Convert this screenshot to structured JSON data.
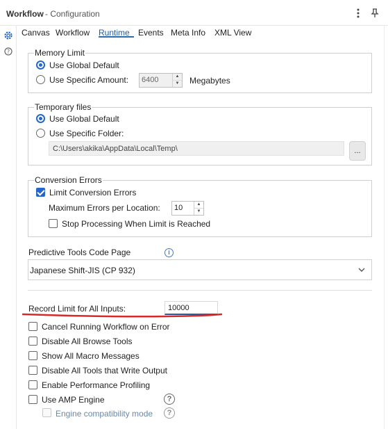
{
  "window": {
    "title": "Workflow",
    "subtitle": "- Configuration"
  },
  "tabs": [
    {
      "label": "Canvas"
    },
    {
      "label": "Workflow"
    },
    {
      "label": "Runtime",
      "active": true
    },
    {
      "label": "Events"
    },
    {
      "label": "Meta Info"
    },
    {
      "label": "XML View"
    }
  ],
  "memory_limit": {
    "legend": "Memory Limit",
    "option_default": "Use Global Default",
    "option_specific": "Use Specific Amount:",
    "amount": "6400",
    "unit": "Megabytes",
    "selected": "default"
  },
  "temp_files": {
    "legend": "Temporary files",
    "option_default": "Use Global Default",
    "option_specific": "Use Specific Folder:",
    "path": "C:\\Users\\akika\\AppData\\Local\\Temp\\",
    "browse_label": "...",
    "selected": "default"
  },
  "conversion_errors": {
    "legend": "Conversion Errors",
    "limit_label": "Limit Conversion Errors",
    "limit_checked": true,
    "max_label": "Maximum Errors per Location:",
    "max_value": "10",
    "stop_label": "Stop Processing When Limit is Reached",
    "stop_checked": false
  },
  "code_page": {
    "label": "Predictive Tools Code Page",
    "value": "Japanese Shift-JIS (CP 932)"
  },
  "record_limit": {
    "label": "Record Limit for All Inputs:",
    "value": "10000"
  },
  "options": [
    {
      "label": "Cancel Running Workflow on Error",
      "checked": false
    },
    {
      "label": "Disable All Browse Tools",
      "checked": false
    },
    {
      "label": "Show All Macro Messages",
      "checked": false
    },
    {
      "label": "Disable All Tools that Write Output",
      "checked": false
    },
    {
      "label": "Enable Performance Profiling",
      "checked": false
    },
    {
      "label": "Use AMP Engine",
      "checked": false
    }
  ],
  "engine_compat": {
    "label": "Engine compatibility mode",
    "checked": false,
    "disabled": true
  },
  "colors": {
    "accent": "#2466c9",
    "annotation": "#d42a2a"
  }
}
